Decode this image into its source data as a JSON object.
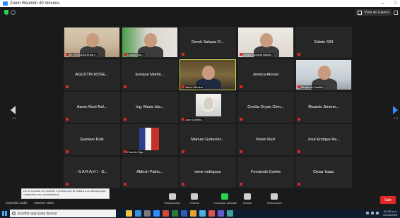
{
  "window": {
    "title": "Zoom Reunión 40 minutos"
  },
  "meeting": {
    "view_label": "Vista de Galería",
    "page_left": "1/2",
    "page_right": "1/2",
    "tiles": [
      {
        "type": "video",
        "bg": "wall",
        "tag": "Br. ORIZAGA Anna I..."
      },
      {
        "type": "video",
        "bg": "green",
        "tag": "Lucero Ana..."
      },
      {
        "type": "name",
        "name": "Derek Salazar R..."
      },
      {
        "type": "video",
        "bg": "light",
        "tag": "Xavier Escobar Bautis..."
      },
      {
        "type": "name",
        "name": "Edwin S/N"
      },
      {
        "type": "name",
        "name": "AGUSTIN ROSE..."
      },
      {
        "type": "name",
        "name": "Enrique Martin..."
      },
      {
        "type": "video",
        "bg": "office",
        "tag": "Jaime Medina",
        "active": true
      },
      {
        "type": "name",
        "name": "Jessica Alonso"
      },
      {
        "type": "video",
        "bg": "room",
        "tag": "Benjamín Castillo"
      },
      {
        "type": "name",
        "name": "Aaron Noel Avil..."
      },
      {
        "type": "name",
        "name": "Ing. Maria Isla..."
      },
      {
        "type": "image",
        "tag": "Juan Castillo..."
      },
      {
        "type": "name",
        "name": "Cecilia Oryan Cóm..."
      },
      {
        "type": "name",
        "name": "Ricardo Jimene..."
      },
      {
        "type": "name",
        "name": "Gustavo Ruiz"
      },
      {
        "type": "flag",
        "tag": "Pamela Dlgs"
      },
      {
        "type": "name",
        "name": "Manuel Gutierrez..."
      },
      {
        "type": "name",
        "name": "Kevin Ruiz"
      },
      {
        "type": "name",
        "name": "Jose Enrique Ra..."
      },
      {
        "type": "name",
        "name": "- S A R A H I - G..."
      },
      {
        "type": "name",
        "name": "Aldrich Patric..."
      },
      {
        "type": "name",
        "name": "irene rodriguez"
      },
      {
        "type": "name",
        "name": "Fernando Cortés"
      },
      {
        "type": "name",
        "name": "Cesar Isaac"
      }
    ]
  },
  "toolbar": {
    "left": [
      "Cancelar Audio",
      "Detener video"
    ],
    "items": [
      {
        "label": "Participantes",
        "count": "42",
        "color": "#cfcfcf"
      },
      {
        "label": "Chatear",
        "color": "#cfcfcf"
      },
      {
        "label": "Compartir pantalla",
        "color": "#2bd24e"
      },
      {
        "label": "Grabar",
        "color": "#cfcfcf"
      },
      {
        "label": "Reacciones",
        "color": "#cfcfcf"
      }
    ],
    "end_label": "Salir"
  },
  "chat_popup": {
    "text": "De mí a todos: Un examen o prueba que se realiza a un alumno para comprobar sus conocimientos..."
  },
  "taskbar": {
    "search_placeholder": "Escribe aquí para buscar",
    "tray_time": "09:45 a.m.",
    "tray_date": "21/11/2020"
  },
  "colors": {
    "accent": "#2d8cff",
    "end": "#e02828",
    "active_border": "#c6d94d"
  }
}
